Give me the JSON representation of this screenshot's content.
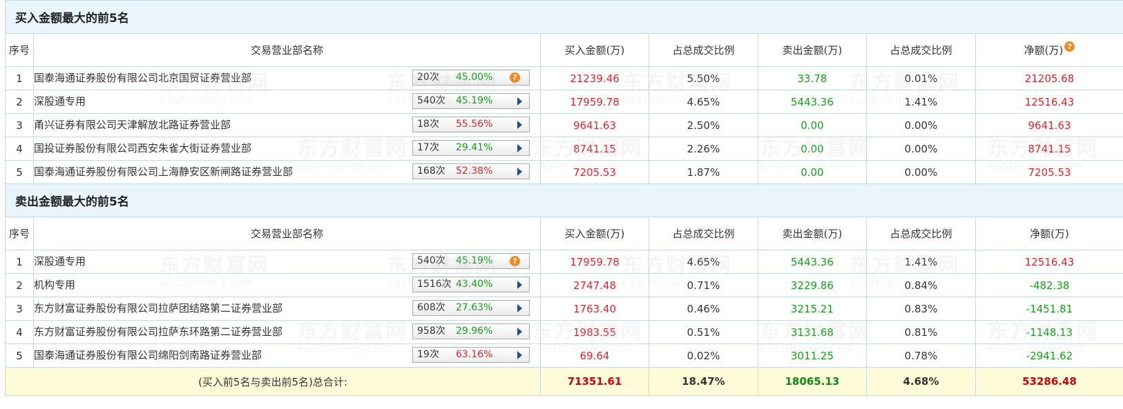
{
  "columns": [
    "序号",
    "交易营业部名称",
    "买入金额(万)",
    "占总成交比例",
    "卖出金额(万)",
    "占总成交比例",
    "净额(万)"
  ],
  "buy_top5": {
    "title": "买入金额最大的前5名",
    "rows": [
      {
        "idx": "1",
        "name": "国泰海通证券股份有限公司北京国贸证券营业部",
        "count": "20次",
        "pct": "45.00%",
        "buy": "21239.46",
        "buy_ratio": "5.50%",
        "sell": "33.78",
        "sell_ratio": "0.01%",
        "net": "21205.68"
      },
      {
        "idx": "2",
        "name": "深股通专用",
        "count": "540次",
        "pct": "45.19%",
        "buy": "17959.78",
        "buy_ratio": "4.65%",
        "sell": "5443.36",
        "sell_ratio": "1.41%",
        "net": "12516.43"
      },
      {
        "idx": "3",
        "name": "甬兴证券有限公司天津解放北路证券营业部",
        "count": "18次",
        "pct": "55.56%",
        "buy": "9641.63",
        "buy_ratio": "2.50%",
        "sell": "0.00",
        "sell_ratio": "0.00%",
        "net": "9641.63"
      },
      {
        "idx": "4",
        "name": "国投证券股份有限公司西安朱雀大街证券营业部",
        "count": "17次",
        "pct": "29.41%",
        "buy": "8741.15",
        "buy_ratio": "2.26%",
        "sell": "0.00",
        "sell_ratio": "0.00%",
        "net": "8741.15"
      },
      {
        "idx": "5",
        "name": "国泰海通证券股份有限公司上海静安区新闸路证券营业部",
        "count": "168次",
        "pct": "52.38%",
        "buy": "7205.53",
        "buy_ratio": "1.87%",
        "sell": "0.00",
        "sell_ratio": "0.00%",
        "net": "7205.53"
      }
    ]
  },
  "sell_top5": {
    "title": "卖出金额最大的前5名",
    "rows": [
      {
        "idx": "1",
        "name": "深股通专用",
        "count": "540次",
        "pct": "45.19%",
        "buy": "17959.78",
        "buy_ratio": "4.65%",
        "sell": "5443.36",
        "sell_ratio": "1.41%",
        "net": "12516.43"
      },
      {
        "idx": "2",
        "name": "机构专用",
        "count": "1516次",
        "pct": "43.40%",
        "buy": "2747.48",
        "buy_ratio": "0.71%",
        "sell": "3229.86",
        "sell_ratio": "0.84%",
        "net": "-482.38"
      },
      {
        "idx": "3",
        "name": "东方财富证券股份有限公司拉萨团结路第二证券营业部",
        "count": "608次",
        "pct": "27.63%",
        "buy": "1763.40",
        "buy_ratio": "0.46%",
        "sell": "3215.21",
        "sell_ratio": "0.83%",
        "net": "-1451.81"
      },
      {
        "idx": "4",
        "name": "东方财富证券股份有限公司拉萨东环路第二证券营业部",
        "count": "958次",
        "pct": "29.96%",
        "buy": "1983.55",
        "buy_ratio": "0.51%",
        "sell": "3131.68",
        "sell_ratio": "0.81%",
        "net": "-1148.13"
      },
      {
        "idx": "5",
        "name": "国泰海通证券股份有限公司绵阳剑南路证券营业部",
        "count": "19次",
        "pct": "63.16%",
        "buy": "69.64",
        "buy_ratio": "0.02%",
        "sell": "3011.25",
        "sell_ratio": "0.78%",
        "net": "-2941.62"
      }
    ]
  },
  "total": {
    "label": "(买入前5名与卖出前5名)总合计:",
    "buy": "71351.61",
    "buy_ratio": "18.47%",
    "sell": "18065.13",
    "sell_ratio": "4.68%",
    "net": "53286.48"
  },
  "help_icon_glyph": "?",
  "watermark": {
    "cn": "东方财富网",
    "en": "eastmoney.com"
  },
  "colors": {
    "positive": "#e4232f",
    "negative": "#14a11a",
    "header_bg": "#eaf4fd",
    "total_bg": "#fffbd8",
    "border": "#c5d8e8"
  }
}
